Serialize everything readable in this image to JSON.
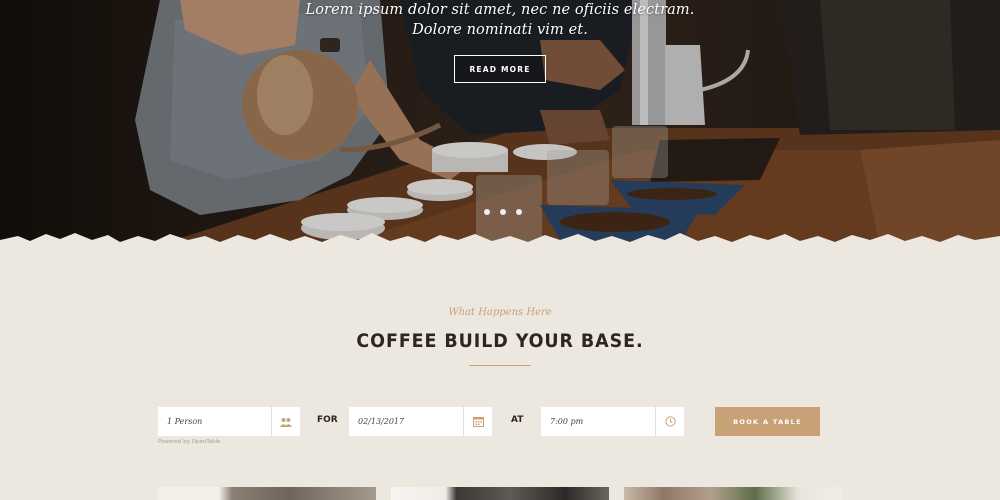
{
  "hero": {
    "line1": "Lorem ipsum dolor sit amet, nec ne oficiis electram.",
    "line2": "Dolore nominati vim et.",
    "button_label": "READ MORE",
    "slides_total": 3,
    "slide_active": 1
  },
  "section": {
    "kicker": "What Happens Here",
    "title": "COFFEE BUILD YOUR BASE."
  },
  "booking": {
    "party_value": "1 Person",
    "party_icon": "people-icon",
    "for_label": "FOR",
    "date_value": "02/13/2017",
    "date_icon": "calendar-icon",
    "at_label": "AT",
    "time_value": "7:00 pm",
    "time_icon": "clock-icon",
    "button_label": "BOOK A TABLE",
    "powered_by": "Powered by OpenTable"
  },
  "colors": {
    "accent": "#c9a176",
    "background": "#ece7df",
    "heading": "#2d2520"
  }
}
